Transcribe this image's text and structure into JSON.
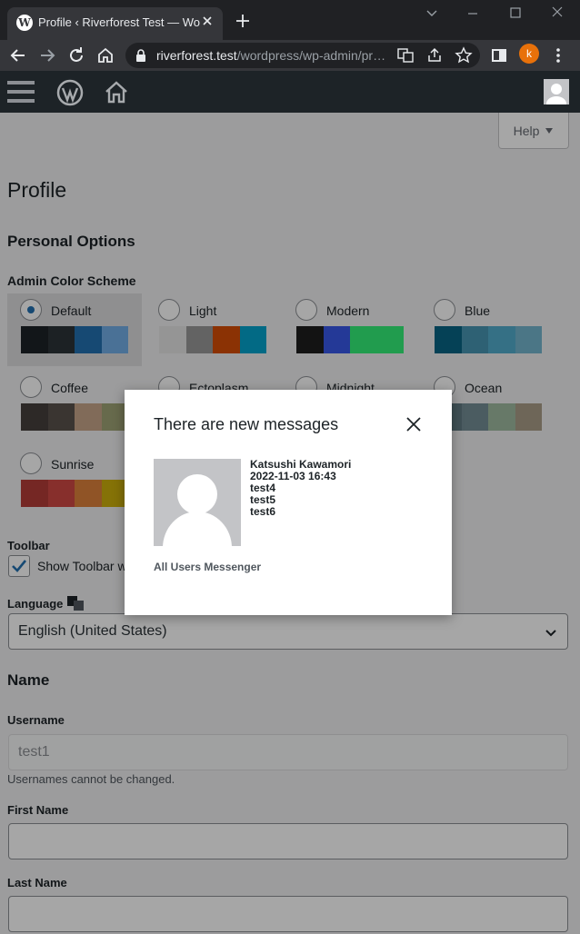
{
  "browser": {
    "tab_title": "Profile ‹ Riverforest Test — WordPress",
    "favicon_letter": "W",
    "url_host": "riverforest.test",
    "url_path": "/wordpress/wp-admin/pr…",
    "profile_initial": "k"
  },
  "help": {
    "label": "Help"
  },
  "page": {
    "title": "Profile",
    "personal_options": "Personal Options",
    "color_scheme_label": "Admin Color Scheme",
    "toolbar_label": "Toolbar",
    "toolbar_checkbox": "Show Toolbar when viewing site",
    "language_label": "Language",
    "language_value": "English (United States)",
    "name_heading": "Name",
    "username_label": "Username",
    "username_value": "test1",
    "username_desc": "Usernames cannot be changed.",
    "first_name_label": "First Name",
    "last_name_label": "Last Name"
  },
  "schemes": [
    {
      "name": "Default",
      "colors": [
        "#1d2327",
        "#2c3338",
        "#2271b1",
        "#72aee6"
      ]
    },
    {
      "name": "Light",
      "colors": [
        "#e5e5e5",
        "#999999",
        "#d64e07",
        "#04a4cc"
      ]
    },
    {
      "name": "Modern",
      "colors": [
        "#1e1e1e",
        "#3858e9",
        "#33f078",
        "#33f078"
      ]
    },
    {
      "name": "Blue",
      "colors": [
        "#096484",
        "#4796b3",
        "#52accc",
        "#74b6ce"
      ]
    },
    {
      "name": "Coffee",
      "colors": [
        "#46403c",
        "#59524c",
        "#c7a589",
        "#9ea476"
      ]
    },
    {
      "name": "Ectoplasm",
      "colors": [
        "#413256",
        "#523f6d",
        "#a3b745",
        "#d46f15"
      ]
    },
    {
      "name": "Midnight",
      "colors": [
        "#25282b",
        "#363b3f",
        "#69a8bb",
        "#e14d43"
      ]
    },
    {
      "name": "Ocean",
      "colors": [
        "#627c83",
        "#738e96",
        "#9ebaa0",
        "#aa9d88"
      ]
    },
    {
      "name": "Sunrise",
      "colors": [
        "#b43c38",
        "#cf4944",
        "#dd823b",
        "#ccaf0b"
      ]
    }
  ],
  "modal": {
    "title": "There are new messages",
    "sender": "Katsushi Kawamori",
    "datetime": "2022-11-03 16:43",
    "lines": [
      "test4",
      "test5",
      "test6"
    ],
    "link": "All Users Messenger"
  }
}
